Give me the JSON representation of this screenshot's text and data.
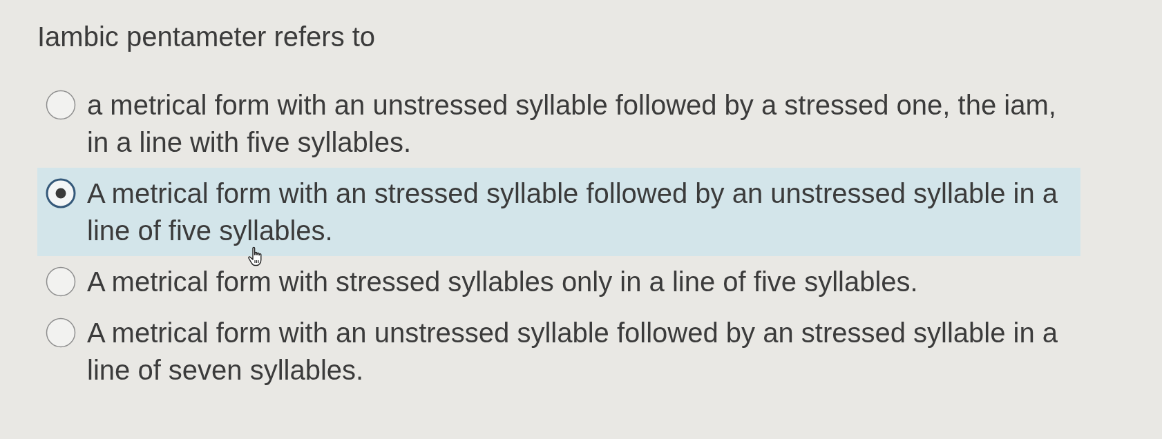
{
  "question": {
    "text": "Iambic pentameter refers to"
  },
  "options": [
    {
      "text": "a metrical form with an unstressed syllable followed by a stressed one, the iam, in a line with five syllables.",
      "selected": false
    },
    {
      "text": "A metrical form with an stressed syllable followed by an unstressed syllable in a line of five syllables.",
      "selected": true
    },
    {
      "text": "A metrical form with stressed syllables only in a line of five syllables.",
      "selected": false
    },
    {
      "text": "A metrical form with an unstressed syllable followed by an stressed syllable in a line of seven syllables.",
      "selected": false
    }
  ]
}
